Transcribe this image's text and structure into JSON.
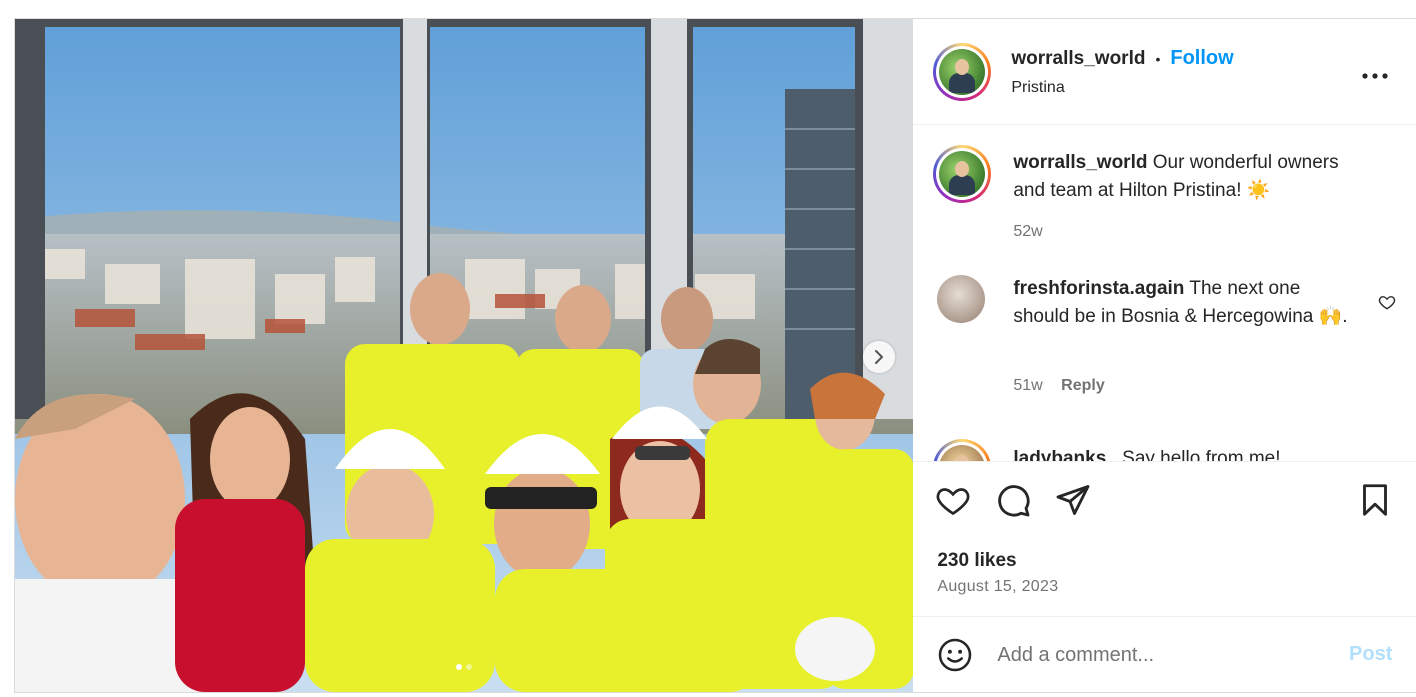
{
  "post": {
    "author": {
      "username": "worralls_world",
      "follow_label": "Follow",
      "separator": "•",
      "location": "Pristina"
    },
    "more_icon": "more-horizontal-icon",
    "caption": {
      "username": "worralls_world",
      "text": "Our wonderful owners and team at Hilton Pristina! ☀️",
      "age": "52w"
    },
    "comments": [
      {
        "username": "freshforinsta.again",
        "text": "The next one should be in Bosnia & Hercegowina 🙌.",
        "age": "51w",
        "reply_label": "Reply"
      },
      {
        "username": "ladybanks_",
        "text": "Say hello from me!"
      }
    ],
    "likes": "230 likes",
    "date": "August 15, 2023",
    "add_comment": {
      "placeholder": "Add a comment...",
      "post_label": "Post"
    },
    "carousel": {
      "total_slides": 2,
      "current_slide": 1
    },
    "colors": {
      "accent": "#0095f6",
      "muted": "#737373",
      "post_disabled": "#b2dffc"
    }
  }
}
